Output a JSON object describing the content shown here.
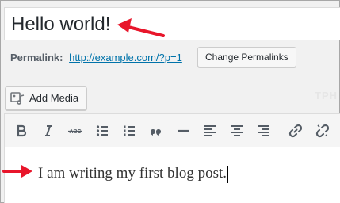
{
  "post": {
    "title": "Hello world!",
    "content": "I am writing my first blog post."
  },
  "permalink": {
    "label": "Permalink:",
    "url": "http://example.com/?p=1",
    "change_button": "Change Permalinks"
  },
  "media": {
    "add_button": "Add Media"
  },
  "watermark": "TPH",
  "toolbar": {
    "buttons": [
      {
        "name": "bold",
        "icon": "bold-icon"
      },
      {
        "name": "italic",
        "icon": "italic-icon"
      },
      {
        "name": "strikethrough",
        "icon": "strikethrough-icon",
        "label": "ABC"
      },
      {
        "name": "bulleted-list",
        "icon": "bulleted-list-icon"
      },
      {
        "name": "numbered-list",
        "icon": "numbered-list-icon"
      },
      {
        "name": "blockquote",
        "icon": "blockquote-icon"
      },
      {
        "name": "horizontal-line",
        "icon": "horizontal-line-icon"
      },
      {
        "name": "align-left",
        "icon": "align-left-icon"
      },
      {
        "name": "align-center",
        "icon": "align-center-icon"
      },
      {
        "name": "align-right",
        "icon": "align-right-icon"
      },
      {
        "name": "insert-link",
        "icon": "link-icon"
      },
      {
        "name": "remove-link",
        "icon": "unlink-icon"
      }
    ]
  },
  "colors": {
    "annotation_arrow": "#e8162b",
    "link": "#0073aa",
    "toolbar_icon": "#555d66"
  }
}
